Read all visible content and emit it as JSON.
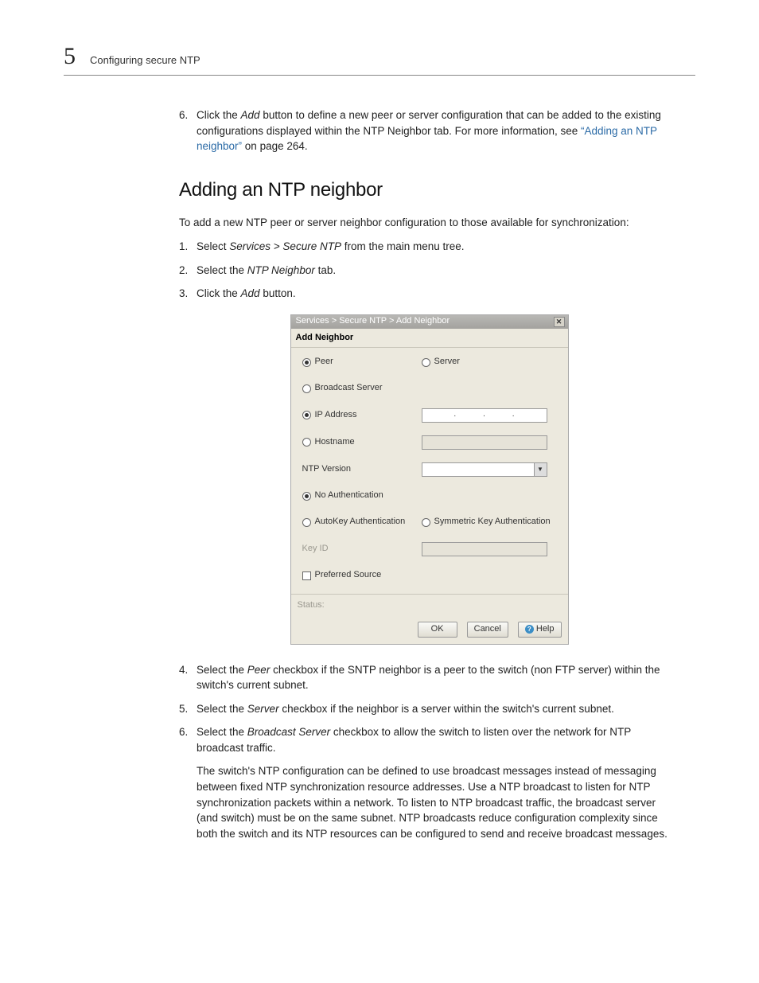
{
  "header": {
    "chapter_number": "5",
    "title": "Configuring secure NTP"
  },
  "intro_step": {
    "num": "6.",
    "pre": "Click the ",
    "em1": "Add",
    "mid": " button to define a new peer or server configuration that can be added to the existing configurations displayed within the NTP Neighbor tab. For more information, see ",
    "link": "“Adding an NTP neighbor”",
    "post": " on page 264."
  },
  "section": {
    "title": "Adding an NTP neighbor",
    "intro": "To add a new NTP peer or server neighbor configuration to those available for synchronization:",
    "steps_top": [
      {
        "num": "1.",
        "parts": [
          "Select ",
          "Services > Secure NTP",
          " from the main menu tree."
        ]
      },
      {
        "num": "2.",
        "parts": [
          "Select the ",
          "NTP Neighbor",
          " tab."
        ]
      },
      {
        "num": "3.",
        "parts": [
          "Click the ",
          "Add",
          " button."
        ]
      }
    ],
    "steps_bottom": [
      {
        "num": "4.",
        "parts": [
          "Select the ",
          "Peer",
          " checkbox if the SNTP neighbor is a peer to the switch (non FTP server) within the switch's current subnet."
        ]
      },
      {
        "num": "5.",
        "parts": [
          "Select the ",
          "Server",
          " checkbox if the neighbor is a server within the switch's current subnet."
        ]
      },
      {
        "num": "6.",
        "parts": [
          "Select the ",
          "Broadcast Server",
          " checkbox to allow the switch to listen over the network for NTP broadcast traffic."
        ]
      }
    ],
    "bottom_para": "The switch's NTP configuration can be defined to use broadcast messages instead of messaging between fixed NTP synchronization resource addresses. Use a NTP broadcast to listen for NTP synchronization packets within a network. To listen to NTP broadcast traffic, the broadcast server (and switch) must be on the same subnet. NTP broadcasts reduce configuration complexity since both the switch and its NTP resources can be configured to send and receive broadcast messages."
  },
  "dialog": {
    "breadcrumb": "Services > Secure NTP > Add Neighbor",
    "section_title": "Add Neighbor",
    "labels": {
      "peer": "Peer",
      "server": "Server",
      "broadcast": "Broadcast Server",
      "ip": "IP Address",
      "hostname": "Hostname",
      "ntp_version": "NTP Version",
      "no_auth": "No Authentication",
      "auto_key": "AutoKey Authentication",
      "sym_key": "Symmetric Key Authentication",
      "key_id": "Key ID",
      "preferred": "Preferred Source",
      "status": "Status:"
    },
    "buttons": {
      "ok": "OK",
      "cancel": "Cancel",
      "help": "Help"
    }
  }
}
